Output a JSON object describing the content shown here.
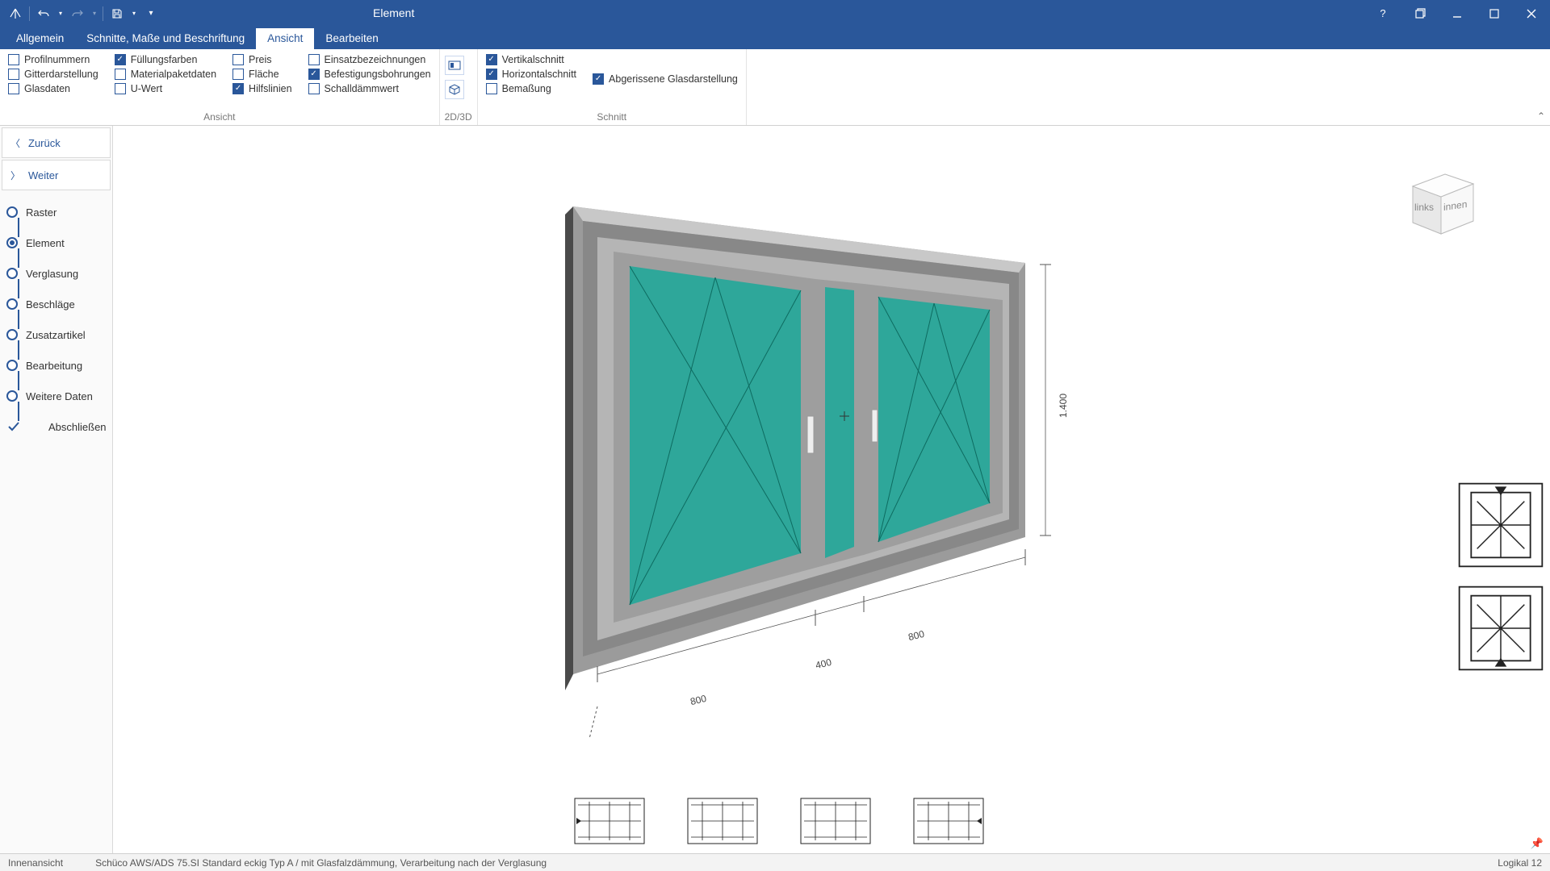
{
  "qat_icons": [
    "nav",
    "undo",
    "redo",
    "save",
    "more"
  ],
  "context_tab": "Element",
  "window_buttons": [
    "help",
    "restore",
    "minimize",
    "maximize",
    "close"
  ],
  "ribbon_tabs": [
    {
      "label": "Allgemein",
      "active": false
    },
    {
      "label": "Schnitte, Maße und Beschriftung",
      "active": false
    },
    {
      "label": "Ansicht",
      "active": true
    },
    {
      "label": "Bearbeiten",
      "active": false
    }
  ],
  "ribbon_groups": {
    "ansicht": {
      "label": "Ansicht",
      "cols": [
        [
          {
            "label": "Profilnummern",
            "checked": false
          },
          {
            "label": "Gitterdarstellung",
            "checked": false
          },
          {
            "label": "Glasdaten",
            "checked": false
          }
        ],
        [
          {
            "label": "Füllungsfarben",
            "checked": true
          },
          {
            "label": "Materialpaketdaten",
            "checked": false
          },
          {
            "label": "U-Wert",
            "checked": false
          }
        ],
        [
          {
            "label": "Preis",
            "checked": false
          },
          {
            "label": "Fläche",
            "checked": false
          },
          {
            "label": "Hilfslinien",
            "checked": true
          }
        ],
        [
          {
            "label": "Einsatzbezeichnungen",
            "checked": false
          },
          {
            "label": "Befestigungsbohrungen",
            "checked": true
          },
          {
            "label": "Schalldämmwert",
            "checked": false
          }
        ]
      ]
    },
    "two_three_d": {
      "label": "2D/3D",
      "buttons": [
        "2d",
        "3d"
      ]
    },
    "schnitt": {
      "label": "Schnitt",
      "cols": [
        [
          {
            "label": "Vertikalschnitt",
            "checked": true
          },
          {
            "label": "Horizontalschnitt",
            "checked": true
          },
          {
            "label": "Bemaßung",
            "checked": false
          }
        ],
        [
          {
            "label": "Abgerissene Glasdarstellung",
            "checked": true
          }
        ]
      ]
    }
  },
  "nav": {
    "back": "Zurück",
    "forward": "Weiter"
  },
  "steps": [
    {
      "label": "Raster",
      "state": "done"
    },
    {
      "label": "Element",
      "state": "current"
    },
    {
      "label": "Verglasung",
      "state": "todo"
    },
    {
      "label": "Beschläge",
      "state": "todo"
    },
    {
      "label": "Zusatzartikel",
      "state": "todo"
    },
    {
      "label": "Bearbeitung",
      "state": "todo"
    },
    {
      "label": "Weitere Daten",
      "state": "todo"
    },
    {
      "label": "Abschließen",
      "state": "final"
    }
  ],
  "viewcube": {
    "left": "links",
    "front": "innen"
  },
  "dimensions": {
    "d1": "800",
    "d2": "400",
    "d3": "800",
    "height": "1.400"
  },
  "status": {
    "left": "Innenansicht",
    "center": "Schüco AWS/ADS 75.SI Standard eckig Typ A / mit Glasfalzdämmung, Verarbeitung nach der Verglasung",
    "right": "Logikal 12"
  }
}
